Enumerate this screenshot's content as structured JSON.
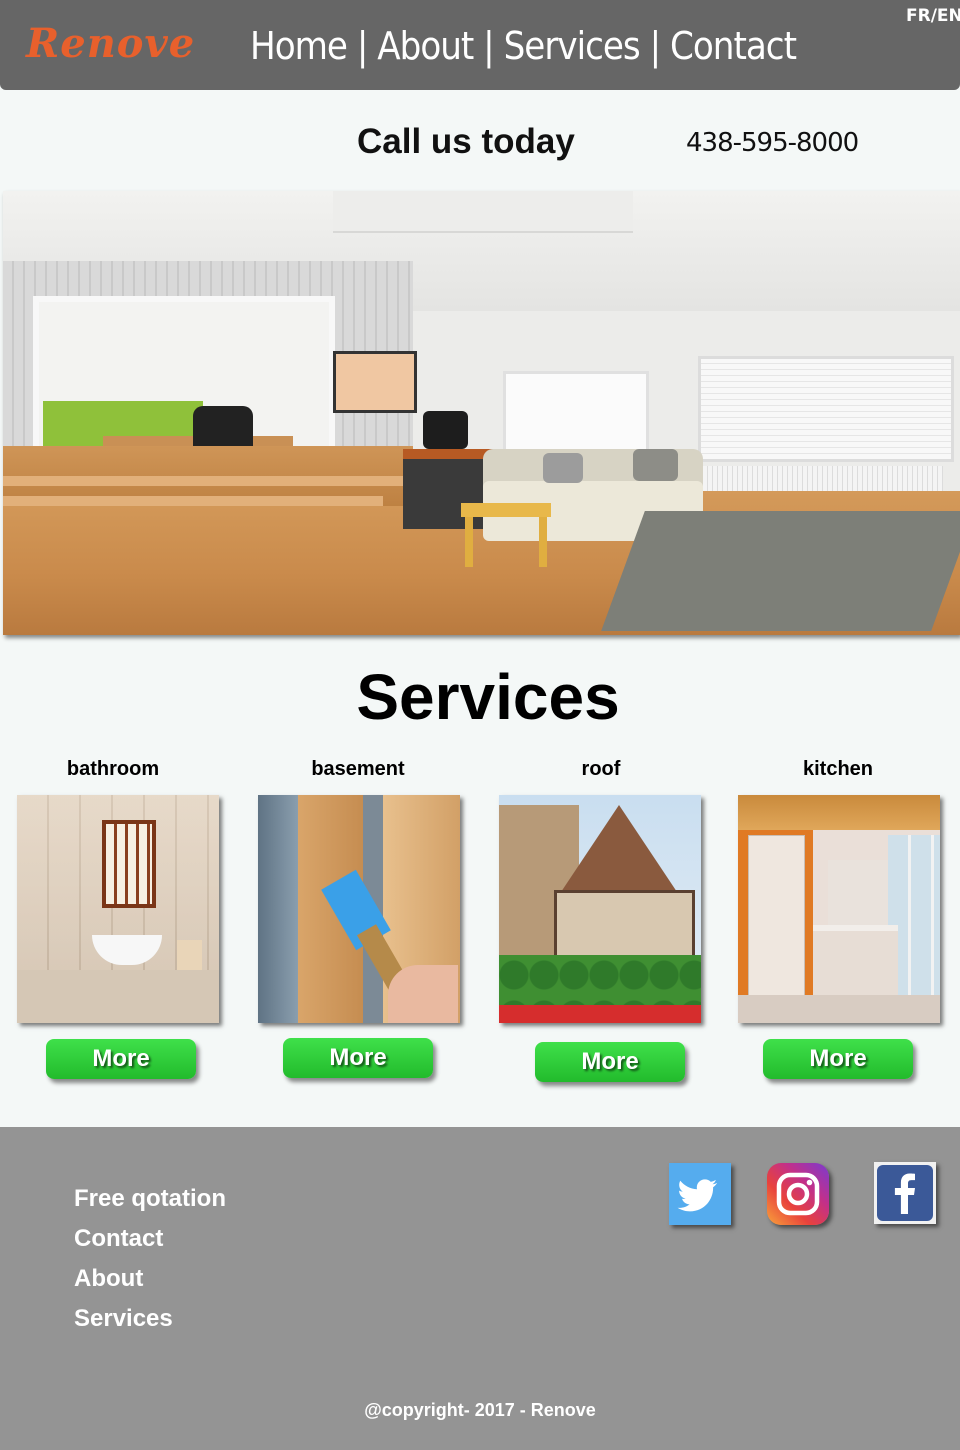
{
  "header": {
    "logo": "Renove",
    "nav": [
      "Home",
      "About",
      "Services",
      "Contact"
    ],
    "separator": "|",
    "language_toggle": "FR/EN"
  },
  "call": {
    "text": "Call us today",
    "phone": "438-595-8000"
  },
  "services": {
    "title": "Services",
    "items": [
      {
        "label": "bathroom",
        "button": "More"
      },
      {
        "label": "basement",
        "button": "More"
      },
      {
        "label": "roof",
        "button": "More"
      },
      {
        "label": "kitchen",
        "button": "More"
      }
    ]
  },
  "footer": {
    "links": [
      "Free qotation",
      "Contact",
      "About",
      "Services"
    ],
    "social": [
      {
        "name": "twitter-icon",
        "color": "#55acee"
      },
      {
        "name": "instagram-icon",
        "color": "#c13584"
      },
      {
        "name": "facebook-icon",
        "color": "#3b5998"
      }
    ],
    "copyright": "@copyright- 2017 - Renove"
  }
}
